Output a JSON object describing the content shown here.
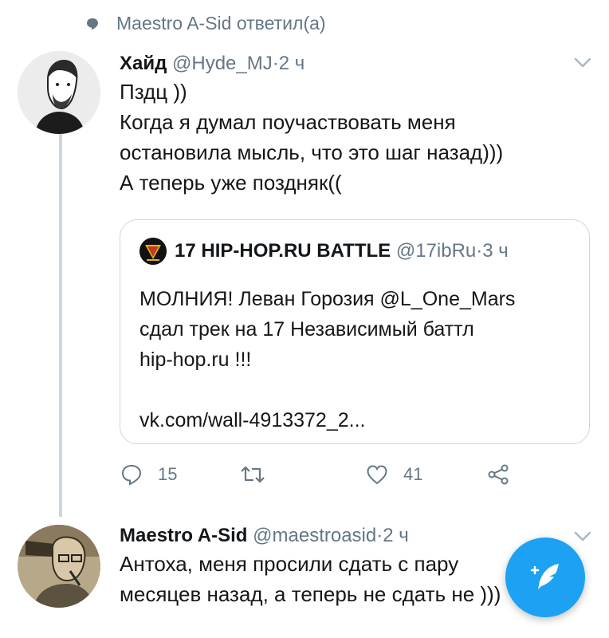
{
  "context": {
    "icon": "reply-bubble-icon",
    "text": "Maestro A-Sid ответил(а)"
  },
  "tweet1": {
    "name": "Хайд",
    "handle": "@Hyde_MJ",
    "dot": " · ",
    "time": "2 ч",
    "lines": [
      "Пздц ))",
      "Когда я думал поучаствовать меня",
      "остановила мысль, что это шаг назад)))",
      "А теперь уже поздняк(("
    ],
    "quote": {
      "name": "17 HIP-HOP.RU BATTLE",
      "handle": "@17ibRu",
      "dot": " · ",
      "time": "3 ч",
      "lines": [
        "МОЛНИЯ!  Леван Горозия @L_One_Mars",
        "сдал трек на 17 Независимый баттл",
        "hip-hop.ru !!!",
        "",
        "vk.com/wall-4913372_2..."
      ]
    },
    "actions": {
      "reply_count": "15",
      "retweet_count": "",
      "like_count": "41"
    }
  },
  "tweet2": {
    "name": "Maestro A-Sid",
    "handle": "@maestroasid",
    "dot": " · ",
    "time": "2 ч",
    "lines": [
      "Антоха, меня просили сдать с пару",
      "месяцев назад, а теперь не сдать не )))"
    ]
  },
  "colors": {
    "accent": "#1da1f2",
    "muted": "#657786",
    "border": "#ccd6dd",
    "text": "#14171a"
  }
}
